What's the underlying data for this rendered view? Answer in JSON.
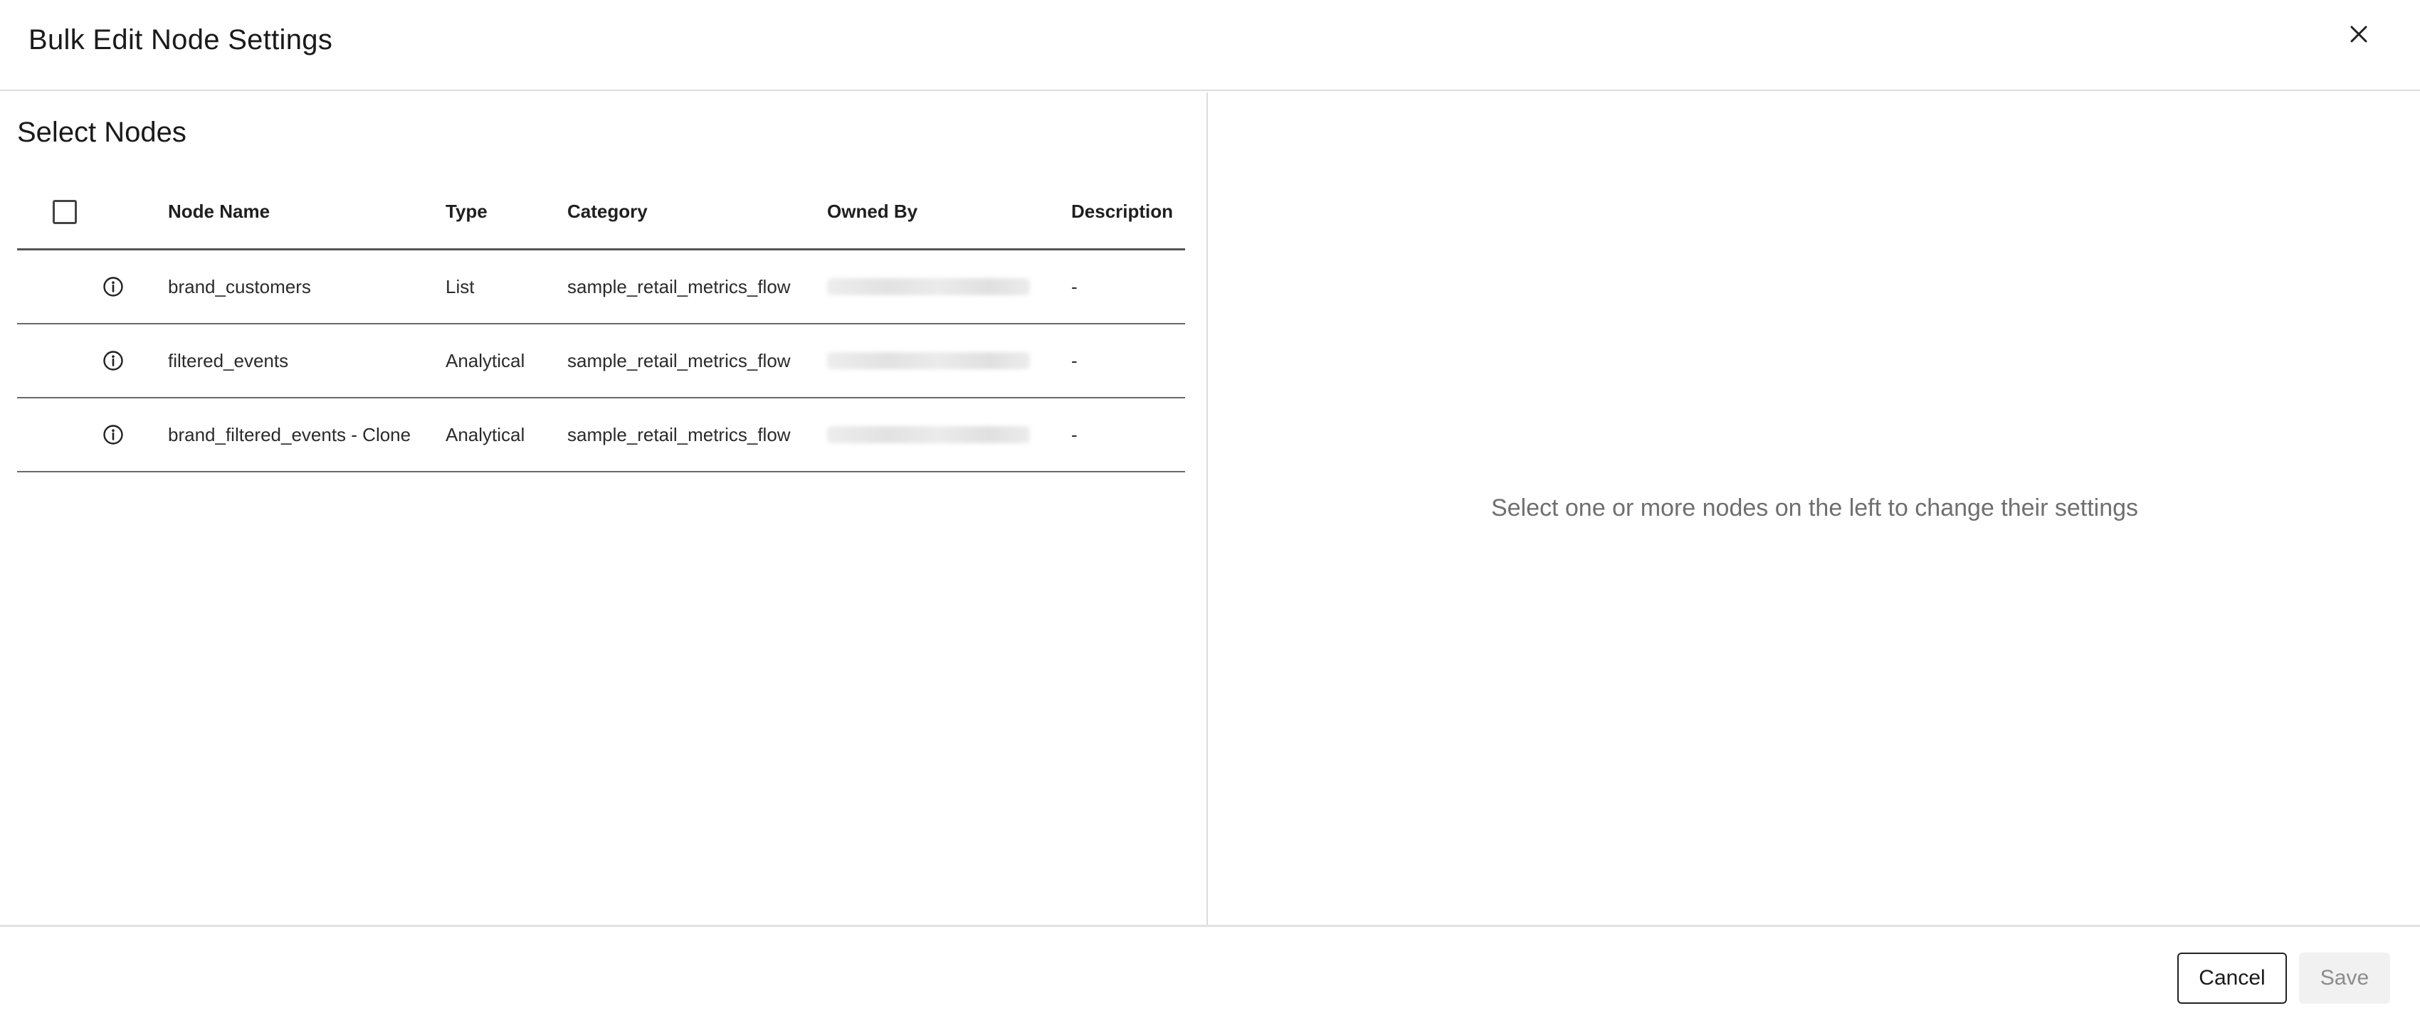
{
  "dialog": {
    "title": "Bulk Edit Node Settings",
    "close_icon": "close-icon"
  },
  "left": {
    "section_title": "Select Nodes",
    "columns": {
      "node_name": "Node Name",
      "type": "Type",
      "category": "Category",
      "owned_by": "Owned By",
      "description": "Description"
    },
    "rows": [
      {
        "name": "brand_customers",
        "type": "List",
        "category": "sample_retail_metrics_flow",
        "description": "-"
      },
      {
        "name": "filtered_events",
        "type": "Analytical",
        "category": "sample_retail_metrics_flow",
        "description": "-"
      },
      {
        "name": "brand_filtered_events - Clone",
        "type": "Analytical",
        "category": "sample_retail_metrics_flow",
        "description": "-"
      }
    ]
  },
  "right": {
    "empty_message": "Select one or more nodes on the left to change their settings"
  },
  "footer": {
    "cancel_label": "Cancel",
    "save_label": "Save"
  }
}
